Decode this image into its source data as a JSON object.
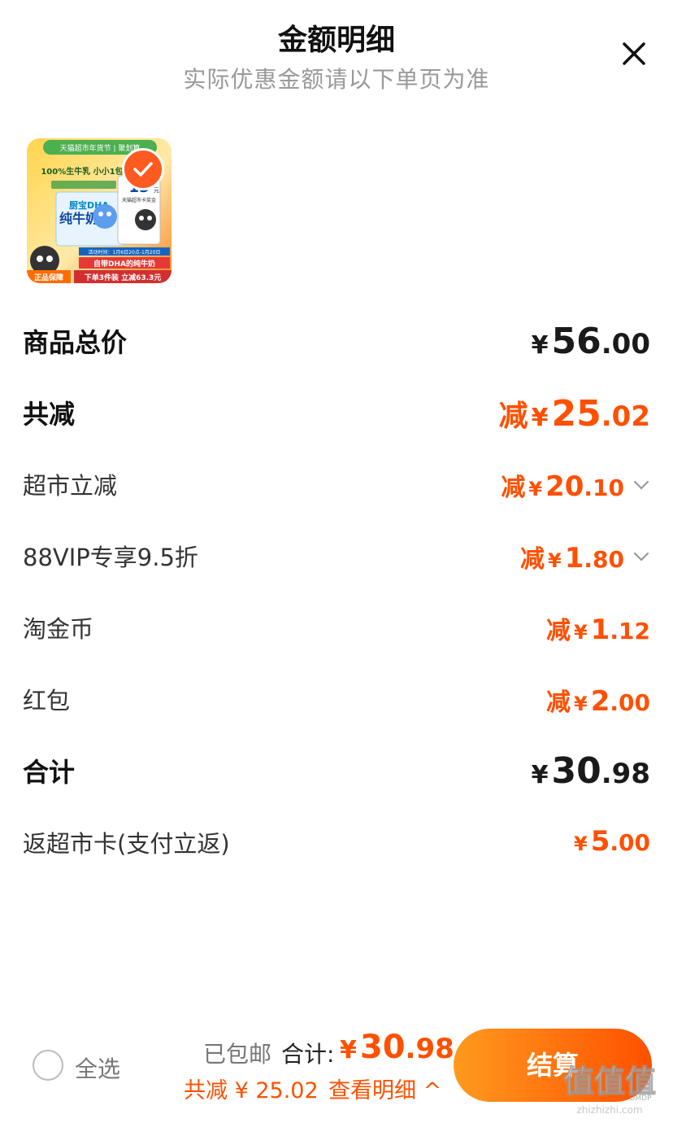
{
  "header": {
    "title": "金额明细",
    "subtitle": "实际优惠金额请以下单页为准"
  },
  "product": {
    "banner_text": "天猫超市年货节 | 聚划算",
    "slogan": "100%生牛乳 小小1包",
    "product_name": "纯牛奶",
    "dha_text": "厨宝DHA",
    "promo_price": "15",
    "promo_unit": "元",
    "promo_sub": "天猫超市卡奖金",
    "promo_date": "活动时间：1月6日20点-1月20日",
    "tagline": "自带DHA的纯牛奶",
    "guarantee": "正品保障",
    "deal": "下单3件装 立减63.3元",
    "selected": true
  },
  "rows": {
    "total_price": {
      "label": "商品总价",
      "yen": "¥",
      "int": "56",
      "dec": ".00"
    },
    "total_discount": {
      "label": "共减",
      "prefix": "减",
      "yen": "¥",
      "int": "25",
      "dec": ".02"
    },
    "supermarket": {
      "label": "超市立减",
      "prefix": "减",
      "yen": "¥",
      "int": "20",
      "dec": ".10"
    },
    "vip": {
      "label": "88VIP专享9.5折",
      "prefix": "减",
      "yen": "¥",
      "int": "1",
      "dec": ".80"
    },
    "coins": {
      "label": "淘金币",
      "prefix": "减",
      "yen": "¥",
      "int": "1",
      "dec": ".12"
    },
    "redpacket": {
      "label": "红包",
      "prefix": "减",
      "yen": "¥",
      "int": "2",
      "dec": ".00"
    },
    "sum": {
      "label": "合计",
      "yen": "¥",
      "int": "30",
      "dec": ".98"
    },
    "card": {
      "label": "返超市卡(支付立返)",
      "yen": "¥",
      "int": "5",
      "dec": ".00"
    }
  },
  "footer": {
    "select_all": "全选",
    "shipped": "已包邮",
    "total_label": "合计:",
    "total_yen": "¥",
    "total_int": "30",
    "total_dec": ".98",
    "saved": "共减 ¥ 25.02",
    "view_detail": "查看明细 ^",
    "checkout": "结算"
  },
  "watermark": {
    "text": "值值值",
    "sub": "zhizhizhi.com",
    "mark": "DMDP"
  },
  "colors": {
    "accent": "#ff5000",
    "checkout_start": "#ff9a1e",
    "checkout_end": "#ff5000"
  },
  "icons": [
    "close-icon",
    "check-icon",
    "chevron-down-icon",
    "radio-icon"
  ]
}
